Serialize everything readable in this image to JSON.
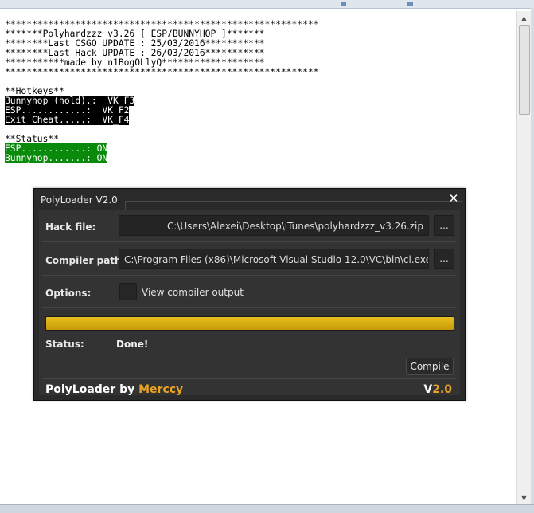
{
  "console": {
    "lines": [
      "**********************************************************",
      "*******Polyhardzzz v3.26 [ ESP/BUNNYHOP ]*******",
      "********Last CSGO UPDATE : 25/03/2016***********",
      "********Last Hack UPDATE : 26/03/2016***********",
      "***********made by n1BogOLlyQ*******************",
      "**********************************************************"
    ],
    "hotkeys_header": "**Hotkeys**",
    "hotkeys": [
      "Bunnyhop (hold).:  VK_F3",
      "ESP............:  VK_F2",
      "Exit Cheat.....:  VK_F4"
    ],
    "status_header": "**Status**",
    "status": [
      "ESP............: ON",
      "Bunnyhop.......: ON"
    ]
  },
  "dialog": {
    "title": "PolyLoader V2.0",
    "close_glyph": "✕",
    "hack_file_label": "Hack file:",
    "hack_file_value": "C:\\Users\\Alexei\\Desktop\\iTunes\\polyhardzzz_v3.26.zip",
    "compiler_path_label": "Compiler path:",
    "compiler_path_value": "C:\\Program Files (x86)\\Microsoft Visual Studio 12.0\\VC\\bin\\cl.exe",
    "browse_label": "...",
    "options_label": "Options:",
    "view_output_label": "View compiler output",
    "view_output_checked": false,
    "progress_percent": 100,
    "status_label": "Status:",
    "status_value": "Done!",
    "compile_label": "Compile",
    "brand_prefix": "PolyLoader by ",
    "brand_name": "Merccy",
    "version_prefix": "V",
    "version_number": "2.0",
    "accent_color": "#e7a321",
    "progress_color": "#d8b014"
  },
  "scrollbar": {
    "up_icon": "▲",
    "down_icon": "▼"
  }
}
